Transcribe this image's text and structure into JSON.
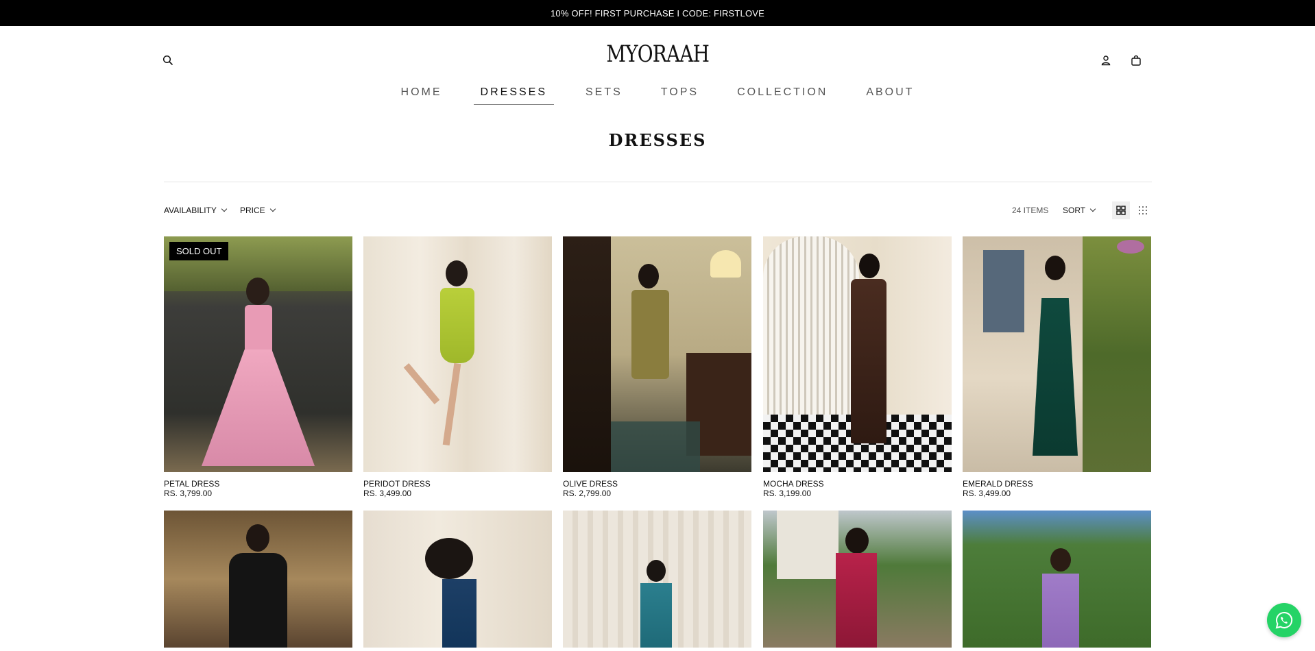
{
  "announcement": "10% OFF! FIRST PURCHASE I CODE: FIRSTLOVE",
  "brand": "MYORAAH",
  "nav": [
    {
      "label": "HOME"
    },
    {
      "label": "DRESSES"
    },
    {
      "label": "SETS"
    },
    {
      "label": "TOPS"
    },
    {
      "label": "COLLECTION"
    },
    {
      "label": "ABOUT"
    }
  ],
  "active_nav": "DRESSES",
  "page_title": "DRESSES",
  "filters": {
    "availability": "AVAILABILITY",
    "price": "PRICE"
  },
  "item_count": "24 ITEMS",
  "sort_label": "SORT",
  "products": [
    {
      "name": "PETAL DRESS",
      "price": "RS. 3,799.00",
      "badge": "SOLD OUT"
    },
    {
      "name": "PERIDOT DRESS",
      "price": "RS. 3,499.00"
    },
    {
      "name": "OLIVE DRESS",
      "price": "RS. 2,799.00"
    },
    {
      "name": "MOCHA DRESS",
      "price": "RS. 3,199.00"
    },
    {
      "name": "EMERALD DRESS",
      "price": "RS. 3,499.00"
    }
  ],
  "colors": {
    "announcement_bg": "#000000",
    "whatsapp": "#25d366"
  },
  "icons": [
    "search-icon",
    "account-icon",
    "bag-icon",
    "grid-large-icon",
    "grid-small-icon",
    "whatsapp-icon"
  ]
}
